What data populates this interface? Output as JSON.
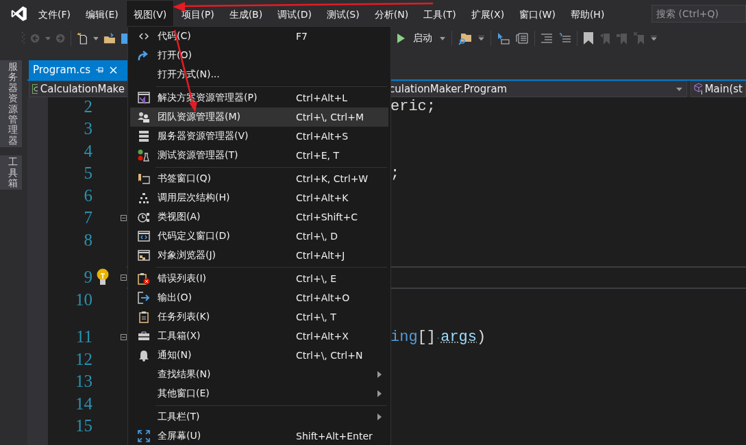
{
  "menubar": {
    "items": [
      {
        "label": "文件(F)",
        "selected": false
      },
      {
        "label": "编辑(E)",
        "selected": false
      },
      {
        "label": "视图(V)",
        "selected": true
      },
      {
        "label": "项目(P)",
        "selected": false
      },
      {
        "label": "生成(B)",
        "selected": false
      },
      {
        "label": "调试(D)",
        "selected": false
      },
      {
        "label": "测试(S)",
        "selected": false
      },
      {
        "label": "分析(N)",
        "selected": false
      },
      {
        "label": "工具(T)",
        "selected": false
      },
      {
        "label": "扩展(X)",
        "selected": false
      },
      {
        "label": "窗口(W)",
        "selected": false
      },
      {
        "label": "帮助(H)",
        "selected": false
      }
    ]
  },
  "search": {
    "placeholder": "搜索 (Ctrl+Q)"
  },
  "toolbar": {
    "start_label": "启动"
  },
  "side_tabs": [
    {
      "label": "服务器资源管理器"
    },
    {
      "label": "工具箱"
    }
  ],
  "editor": {
    "tab": {
      "title": "Program.cs",
      "selected": true
    },
    "nav": {
      "project": "CalculationMake",
      "type": "culationMaker.Program",
      "member": "Main(st"
    },
    "lines": [
      {
        "number": "2",
        "tokens": [
          {
            "kind": "plain",
            "text": "eric;"
          }
        ]
      },
      {
        "number": "3"
      },
      {
        "number": "4"
      },
      {
        "number": "5",
        "tokens": [
          {
            "kind": "plain",
            "text": ";"
          }
        ]
      },
      {
        "number": "6"
      },
      {
        "number": "7",
        "collapsible": true
      },
      {
        "number": "8"
      },
      {
        "number": "9",
        "hint": true,
        "collapsible": true
      },
      {
        "number": "10"
      },
      {
        "number": "11",
        "collapsible": true,
        "tokens": [
          {
            "kind": "keyword",
            "text": "ing"
          },
          {
            "kind": "plain",
            "text": "[]"
          },
          {
            "kind": "space",
            "text": "·"
          },
          {
            "kind": "param",
            "text": "args"
          },
          {
            "kind": "plain",
            "text": ")"
          }
        ]
      },
      {
        "number": "12"
      },
      {
        "number": "13"
      },
      {
        "number": "14"
      },
      {
        "number": "15"
      }
    ]
  },
  "view_menu": {
    "groups": [
      [
        {
          "label": "代码(C)",
          "shortcut": "F7",
          "selected": false
        },
        {
          "label": "打开(O)",
          "selected": false
        },
        {
          "label": "打开方式(N)...",
          "selected": false
        }
      ],
      [
        {
          "label": "解决方案资源管理器(P)",
          "shortcut": "Ctrl+Alt+L",
          "selected": false
        },
        {
          "label": "团队资源管理器(M)",
          "shortcut": "Ctrl+\\, Ctrl+M",
          "selected": true
        },
        {
          "label": "服务器资源管理器(V)",
          "shortcut": "Ctrl+Alt+S",
          "selected": false
        },
        {
          "label": "测试资源管理器(T)",
          "shortcut": "Ctrl+E, T",
          "selected": false
        }
      ],
      [
        {
          "label": "书签窗口(Q)",
          "shortcut": "Ctrl+K, Ctrl+W",
          "selected": false
        },
        {
          "label": "调用层次结构(H)",
          "shortcut": "Ctrl+Alt+K",
          "selected": false
        },
        {
          "label": "类视图(A)",
          "shortcut": "Ctrl+Shift+C",
          "selected": false
        },
        {
          "label": "代码定义窗口(D)",
          "shortcut": "Ctrl+\\, D",
          "selected": false
        },
        {
          "label": "对象浏览器(J)",
          "shortcut": "Ctrl+Alt+J",
          "selected": false
        }
      ],
      [
        {
          "label": "错误列表(I)",
          "shortcut": "Ctrl+\\, E",
          "selected": false
        },
        {
          "label": "输出(O)",
          "shortcut": "Ctrl+Alt+O",
          "selected": false
        },
        {
          "label": "任务列表(K)",
          "shortcut": "Ctrl+\\, T",
          "selected": false
        },
        {
          "label": "工具箱(X)",
          "shortcut": "Ctrl+Alt+X",
          "selected": false
        },
        {
          "label": "通知(N)",
          "shortcut": "Ctrl+\\, Ctrl+N",
          "selected": false
        },
        {
          "label": "查找结果(N)",
          "selected": false,
          "submenu": true
        },
        {
          "label": "其他窗口(E)",
          "selected": false,
          "submenu": true
        }
      ],
      [
        {
          "label": "工具栏(T)",
          "selected": false,
          "submenu": true
        },
        {
          "label": "全屏幕(U)",
          "shortcut": "Shift+Alt+Enter",
          "selected": false
        }
      ]
    ]
  }
}
